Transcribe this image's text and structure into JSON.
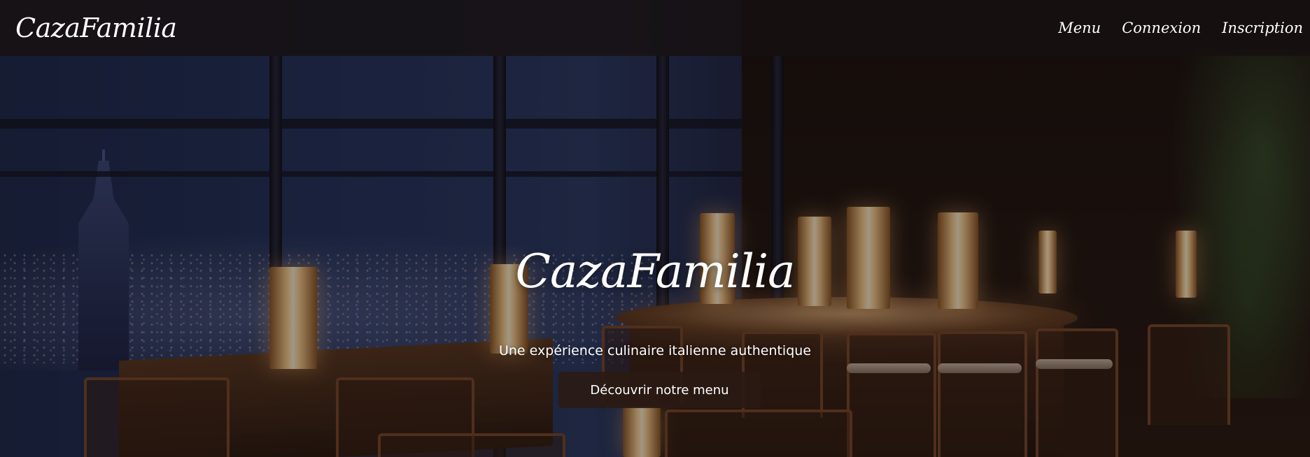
{
  "header": {
    "brand": "CazaFamilia",
    "nav": [
      {
        "label": "Menu"
      },
      {
        "label": "Connexion"
      },
      {
        "label": "Inscription"
      }
    ]
  },
  "hero": {
    "title": "CazaFamilia",
    "subtitle": "Une expérience culinaire italienne authentique",
    "cta_label": "Découvrir notre menu",
    "background_image": "restaurant-bar-night-city-view"
  },
  "colors": {
    "header_bg": "#161010",
    "cta_bg": "#2a1a14",
    "text": "#ffffff"
  }
}
